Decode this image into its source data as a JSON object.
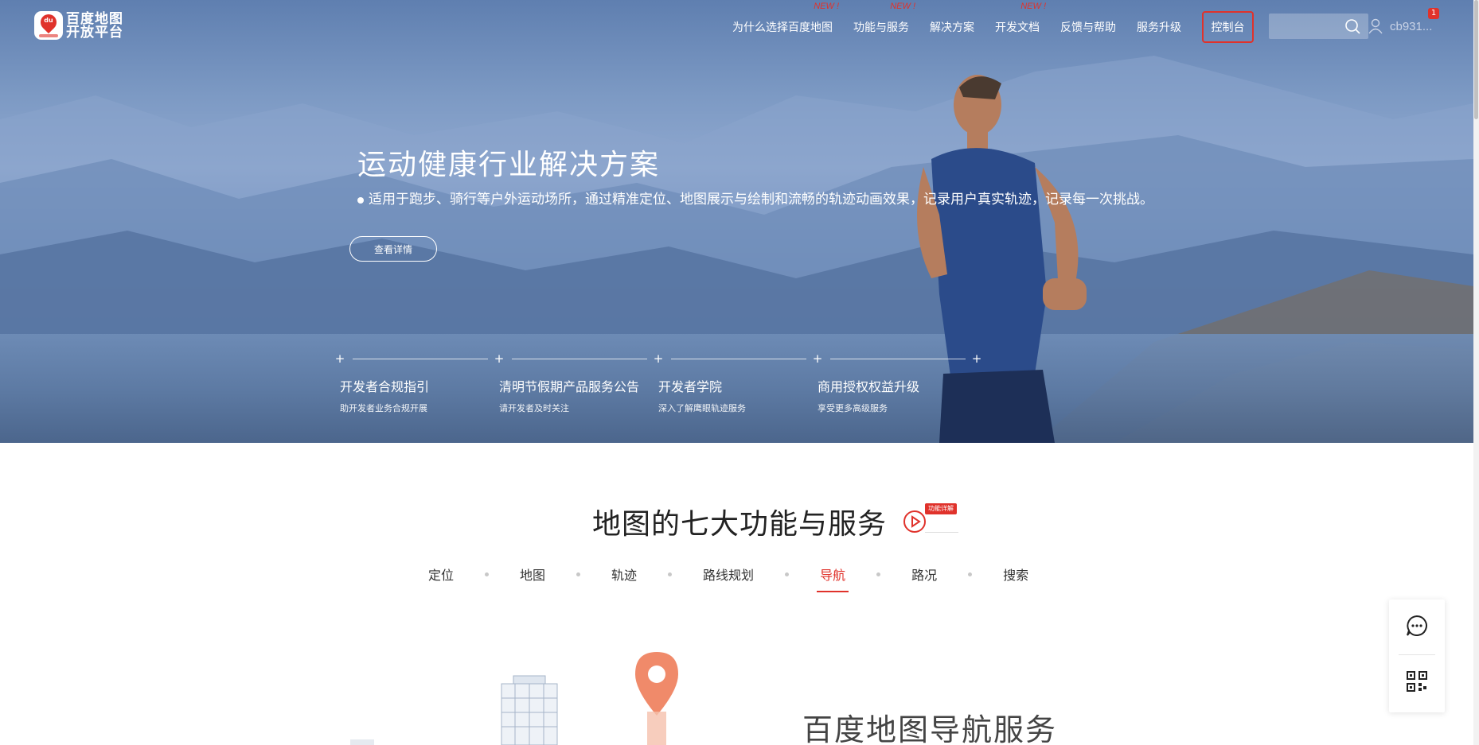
{
  "brand": {
    "line1": "百度地图",
    "line2": "开放平台",
    "mark": "du"
  },
  "nav": {
    "items": [
      {
        "label": "为什么选择百度地图",
        "new": "NEW !"
      },
      {
        "label": "功能与服务",
        "new": "NEW !"
      },
      {
        "label": "解决方案",
        "new": ""
      },
      {
        "label": "开发文档",
        "new": "NEW !"
      },
      {
        "label": "反馈与帮助",
        "new": ""
      },
      {
        "label": "服务升级",
        "new": ""
      }
    ],
    "console": "控制台",
    "search_placeholder": "",
    "user_name": "cb931...",
    "badge": "1"
  },
  "hero": {
    "title": "运动健康行业解决方案",
    "desc": "适用于跑步、骑行等户外运动场所，通过精准定位、地图展示与绘制和流畅的轨迹动画效果，记录用户真实轨迹，记录每一次挑战。",
    "button": "查看详情"
  },
  "news": [
    {
      "title": "开发者合规指引",
      "sub": "助开发者业务合规开展"
    },
    {
      "title": "清明节假期产品服务公告",
      "sub": "请开发者及时关注"
    },
    {
      "title": "开发者学院",
      "sub": "深入了解鹰眼轨迹服务"
    },
    {
      "title": "商用授权权益升级",
      "sub": "享受更多高级服务"
    }
  ],
  "section": {
    "title": "地图的七大功能与服务",
    "tag": "功能详解",
    "tabs": [
      "定位",
      "地图",
      "轨迹",
      "路线规划",
      "导航",
      "路况",
      "搜索"
    ],
    "active_tab": "导航",
    "subtitle": "百度地图导航服务"
  },
  "colors": {
    "accent": "#e0322b"
  },
  "icons": {
    "search": "search-icon",
    "user": "user-icon",
    "chat": "chat-icon",
    "qr": "qr-code-icon",
    "play": "play-icon"
  }
}
